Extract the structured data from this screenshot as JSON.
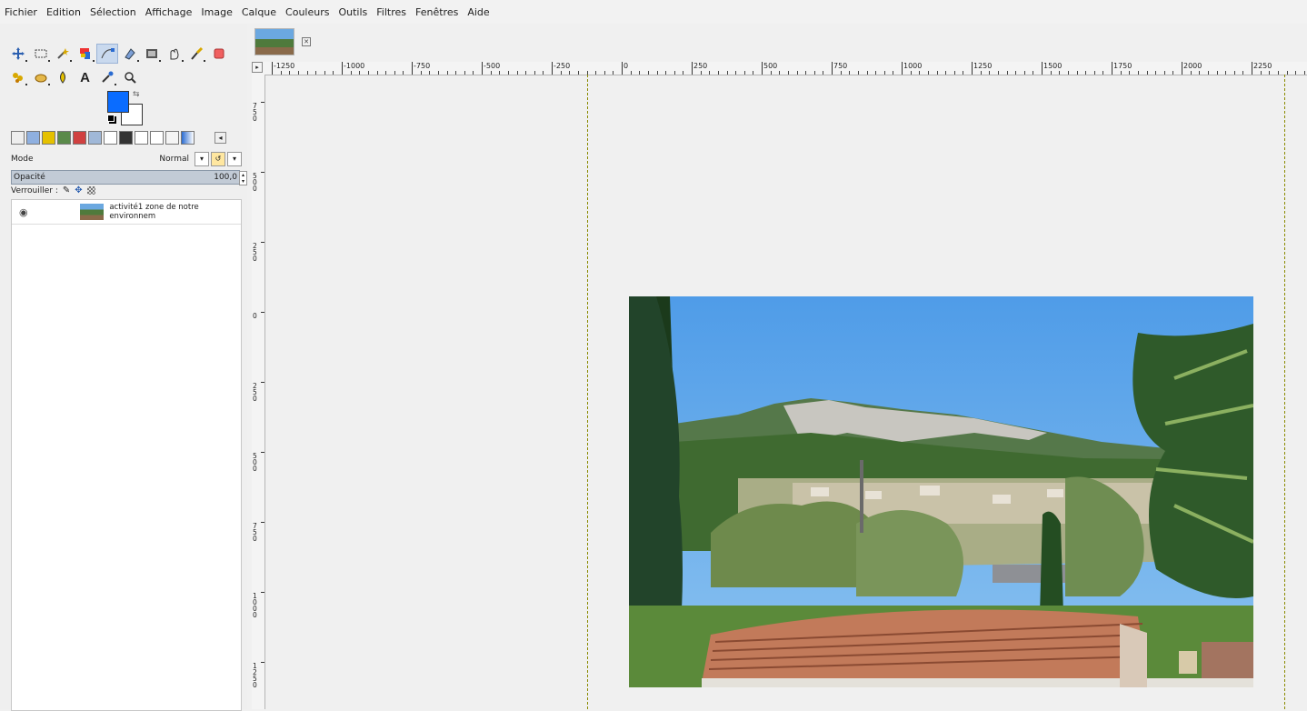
{
  "menu": [
    "Fichier",
    "Edition",
    "Sélection",
    "Affichage",
    "Image",
    "Calque",
    "Couleurs",
    "Outils",
    "Filtres",
    "Fenêtres",
    "Aide"
  ],
  "toolbox": {
    "row1": [
      "move-icon",
      "rect-select-icon",
      "fuzzy-select-icon",
      "color-select-icon",
      "paths-icon",
      "paint-select-icon",
      "heal-icon",
      "smudge-icon",
      "paintbrush-icon",
      "eraser-icon"
    ],
    "row2": [
      "clone-icon",
      "align-icon",
      "dodge-icon",
      "text-icon",
      "color-picker-icon",
      "zoom-icon"
    ],
    "text_glyph": "A"
  },
  "colors": {
    "foreground": "#0a6cff",
    "background": "#ffffff"
  },
  "layers_panel": {
    "mode_label": "Mode",
    "mode_value": "Normal",
    "opacity_label": "Opacité",
    "opacity_value": "100,0",
    "lock_label": "Verrouiller :",
    "layer": {
      "name": "activité1 zone de notre environnem",
      "visible": true
    }
  },
  "canvas": {
    "ruler_h": [
      "-1250",
      "-1000",
      "-750",
      "-500",
      "-250",
      "0",
      "250",
      "500",
      "750",
      "1000",
      "1250",
      "1500",
      "1750",
      "2000",
      "2250"
    ],
    "ruler_v": [
      "750",
      "500",
      "250",
      "0",
      "250",
      "500",
      "750",
      "1000",
      "1250"
    ]
  }
}
